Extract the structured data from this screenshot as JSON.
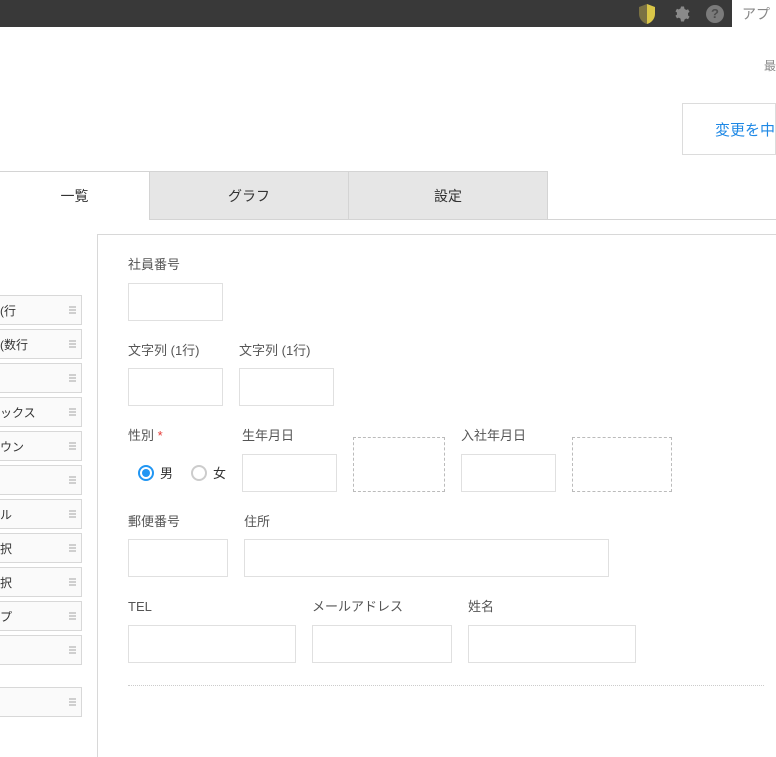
{
  "topbar": {
    "app_settings_label": "アプ"
  },
  "upper": {
    "status_note": "最",
    "action_button_label": "変更を中"
  },
  "tabs": {
    "list": "一覧",
    "chart": "グラフ",
    "settings": "設定"
  },
  "palette": {
    "items": [
      "行)",
      "数行)",
      "",
      "ックス",
      "ウン",
      "",
      "ル",
      "択",
      "択",
      "プ",
      ""
    ]
  },
  "form": {
    "employee_number": {
      "label": "社員番号"
    },
    "string1": {
      "label": "文字列 (1行)"
    },
    "string2": {
      "label": "文字列 (1行)"
    },
    "gender": {
      "label": "性別",
      "options": {
        "male": "男",
        "female": "女"
      },
      "selected": "male"
    },
    "birthdate": {
      "label": "生年月日"
    },
    "hiredate": {
      "label": "入社年月日"
    },
    "postal": {
      "label": "郵便番号"
    },
    "address": {
      "label": "住所"
    },
    "tel": {
      "label": "TEL"
    },
    "email": {
      "label": "メールアドレス"
    },
    "name": {
      "label": "姓名"
    }
  }
}
